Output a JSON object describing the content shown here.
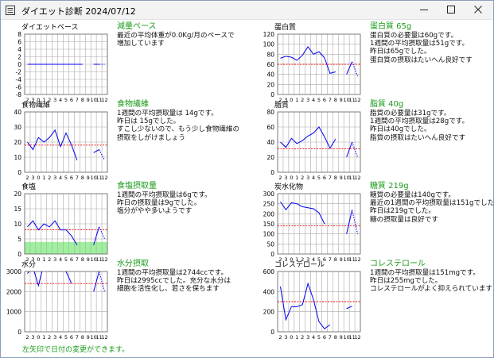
{
  "window": {
    "title": "ダイエット診断 2024/07/12",
    "icon": "list-icon",
    "controls": {
      "minimize": "minimize-icon",
      "maximize": "maximize-icon",
      "close": "close-icon"
    }
  },
  "colors": {
    "line": "#0000ee",
    "reference": "#ee0000",
    "grid": "#aaaaaa",
    "band": "#9ef09e",
    "heading": "#1a9a1a"
  },
  "x_tick_labels": [
    "2",
    "3",
    "0",
    "1",
    "2",
    "3",
    "4",
    "5",
    "6",
    "7",
    "8",
    "9",
    "10",
    "11",
    "12"
  ],
  "footer": "左矢印で日付の変更ができます。",
  "panels": [
    {
      "key": "weight",
      "heading": "減量ペース",
      "lines": [
        "最近の平均体重が0.0Kg/月のペースで",
        "増加しています"
      ]
    },
    {
      "key": "protein",
      "heading": "蛋白質 65g",
      "lines": [
        "蛋白質の必要量は60gです。",
        "1週間の平均摂取量は51gです。",
        "昨日は65gでした。",
        "蛋白質の摂取はたいへん良好です"
      ]
    },
    {
      "key": "fiber",
      "heading": "食物繊維",
      "lines": [
        "1週間の平均摂取量は 14gです。",
        "昨日は 15gでした。",
        "すこし少ないので、もう少し食物繊維の",
        "摂取をしがけましょう"
      ]
    },
    {
      "key": "fat",
      "heading": "脂質 40g",
      "lines": [
        "脂質の必要量は31gです。",
        "1週間の平均摂取量は28gです。",
        "昨日は40gでした。",
        "脂質の摂取はたいへん良好です"
      ]
    },
    {
      "key": "salt",
      "heading": "食塩摂取量",
      "lines": [
        "1週間の平均摂取量は6gです。",
        "昨日の摂取量は9gでした。",
        "塩分がやや多いようです"
      ]
    },
    {
      "key": "carb",
      "heading": "糖質 219g",
      "lines": [
        "糖質の必要量は140gです。",
        "最近の1週間の平均摂取量は151gでした。",
        "昨日は219gでした。",
        "糖の摂取量は良好です"
      ]
    },
    {
      "key": "water",
      "heading": "水分摂取",
      "lines": [
        "1週間の平均摂取量は2744ccです。",
        "昨日は2995ccでした。充分な水分は",
        "細胞を活性化し、若さを保ちます"
      ]
    },
    {
      "key": "chol",
      "heading": "コレステロール",
      "lines": [
        "1週間の平均摂取量は151mgです。",
        "昨日は255mgでした。",
        "コレステロールがよく抑えられています"
      ]
    }
  ],
  "chart_data": [
    {
      "type": "line",
      "title": "ダイエットベース",
      "x": [
        "2",
        "3",
        "0",
        "1",
        "2",
        "3",
        "4",
        "5",
        "6",
        "7",
        "8",
        "9",
        "10",
        "11",
        "12"
      ],
      "ylim": [
        -8,
        8
      ],
      "yticks": [
        8,
        6,
        4,
        2,
        0,
        -2,
        -4,
        -6,
        -8
      ],
      "series": [
        {
          "values": [
            0,
            0,
            0,
            0,
            0,
            0,
            0,
            0,
            0,
            0,
            0,
            null,
            0,
            0,
            null
          ]
        }
      ],
      "dashed_tail": [
        0,
        0
      ],
      "reference": null,
      "band": null,
      "grid": true
    },
    {
      "type": "line",
      "title": "蛋白質",
      "x": [
        "2",
        "3",
        "0",
        "1",
        "2",
        "3",
        "4",
        "5",
        "6",
        "7",
        "8",
        "9",
        "10",
        "11",
        "12"
      ],
      "ylim": [
        0,
        120
      ],
      "yticks": [
        120,
        100,
        80,
        60,
        40,
        20,
        0
      ],
      "series": [
        {
          "values": [
            72,
            76,
            74,
            68,
            78,
            95,
            80,
            85,
            73,
            42,
            45,
            null,
            40,
            65,
            null
          ]
        }
      ],
      "dashed_tail": [
        65,
        36
      ],
      "reference": 60,
      "band": null,
      "grid": true
    },
    {
      "type": "line",
      "title": "食物繊維",
      "x": [
        "2",
        "3",
        "0",
        "1",
        "2",
        "3",
        "4",
        "5",
        "6",
        "7",
        "8",
        "9",
        "10",
        "11",
        "12"
      ],
      "ylim": [
        0,
        40
      ],
      "yticks": [
        40,
        30,
        20,
        10,
        0
      ],
      "series": [
        {
          "values": [
            20,
            15,
            23,
            20,
            23,
            28,
            17,
            26,
            18,
            8,
            null,
            null,
            13,
            15,
            null
          ]
        }
      ],
      "dashed_tail": [
        15,
        8
      ],
      "reference": 18,
      "band": null,
      "grid": true
    },
    {
      "type": "line",
      "title": "脂質",
      "x": [
        "2",
        "3",
        "0",
        "1",
        "2",
        "3",
        "4",
        "5",
        "6",
        "7",
        "8",
        "9",
        "10",
        "11",
        "12"
      ],
      "ylim": [
        0,
        80
      ],
      "yticks": [
        80,
        60,
        40,
        20,
        0
      ],
      "series": [
        {
          "values": [
            40,
            33,
            45,
            38,
            42,
            48,
            52,
            60,
            47,
            32,
            44,
            null,
            20,
            40,
            null
          ]
        }
      ],
      "dashed_tail": [
        40,
        20
      ],
      "reference": 31,
      "band": null,
      "grid": true
    },
    {
      "type": "line",
      "title": "食塩",
      "x": [
        "2",
        "3",
        "0",
        "1",
        "2",
        "3",
        "4",
        "5",
        "6",
        "7",
        "8",
        "9",
        "10",
        "11",
        "12"
      ],
      "ylim": [
        0,
        20
      ],
      "yticks": [
        20,
        15,
        10,
        5,
        0
      ],
      "series": [
        {
          "values": [
            9,
            11,
            8,
            10,
            9,
            11,
            8,
            8,
            6,
            3,
            null,
            null,
            3,
            9,
            null
          ]
        }
      ],
      "dashed_tail": [
        9,
        5
      ],
      "reference": 8,
      "band": [
        0,
        4
      ],
      "grid": true
    },
    {
      "type": "line",
      "title": "炭水化物",
      "x": [
        "2",
        "3",
        "0",
        "1",
        "2",
        "3",
        "4",
        "5",
        "6",
        "7",
        "8",
        "9",
        "10",
        "11",
        "12"
      ],
      "ylim": [
        0,
        300
      ],
      "yticks": [
        300,
        250,
        200,
        150,
        100,
        50,
        0
      ],
      "series": [
        {
          "values": [
            260,
            220,
            255,
            250,
            235,
            230,
            225,
            205,
            150,
            null,
            null,
            null,
            100,
            219,
            null
          ]
        }
      ],
      "dashed_tail": [
        219,
        100
      ],
      "reference": 140,
      "band": null,
      "grid": true
    },
    {
      "type": "line",
      "title": "水分",
      "x": [
        "2",
        "3",
        "0",
        "1",
        "2",
        "3",
        "4",
        "5",
        "6",
        "7",
        "8",
        "9",
        "10",
        "11",
        "12"
      ],
      "ylim": [
        0,
        3000
      ],
      "yticks": [
        3000,
        2000,
        1000,
        0
      ],
      "series": [
        {
          "values": [
            2900,
            3200,
            2300,
            3400,
            3000,
            3300,
            3500,
            3000,
            2400,
            null,
            null,
            null,
            2000,
            2995,
            null
          ]
        }
      ],
      "dashed_tail": [
        2995,
        2000
      ],
      "reference": 2400,
      "band": null,
      "grid": true
    },
    {
      "type": "line",
      "title": "コレステロール",
      "x": [
        "2",
        "3",
        "0",
        "1",
        "2",
        "3",
        "4",
        "5",
        "6",
        "7",
        "8",
        "9",
        "10",
        "11",
        "12"
      ],
      "ylim": [
        0,
        600
      ],
      "yticks": [
        600,
        400,
        200,
        0
      ],
      "series": [
        {
          "values": [
            450,
            120,
            250,
            250,
            270,
            480,
            320,
            100,
            30,
            70,
            null,
            null,
            230,
            255,
            null
          ]
        }
      ],
      "dashed_tail": null,
      "reference": 300,
      "band": null,
      "grid": true
    }
  ]
}
